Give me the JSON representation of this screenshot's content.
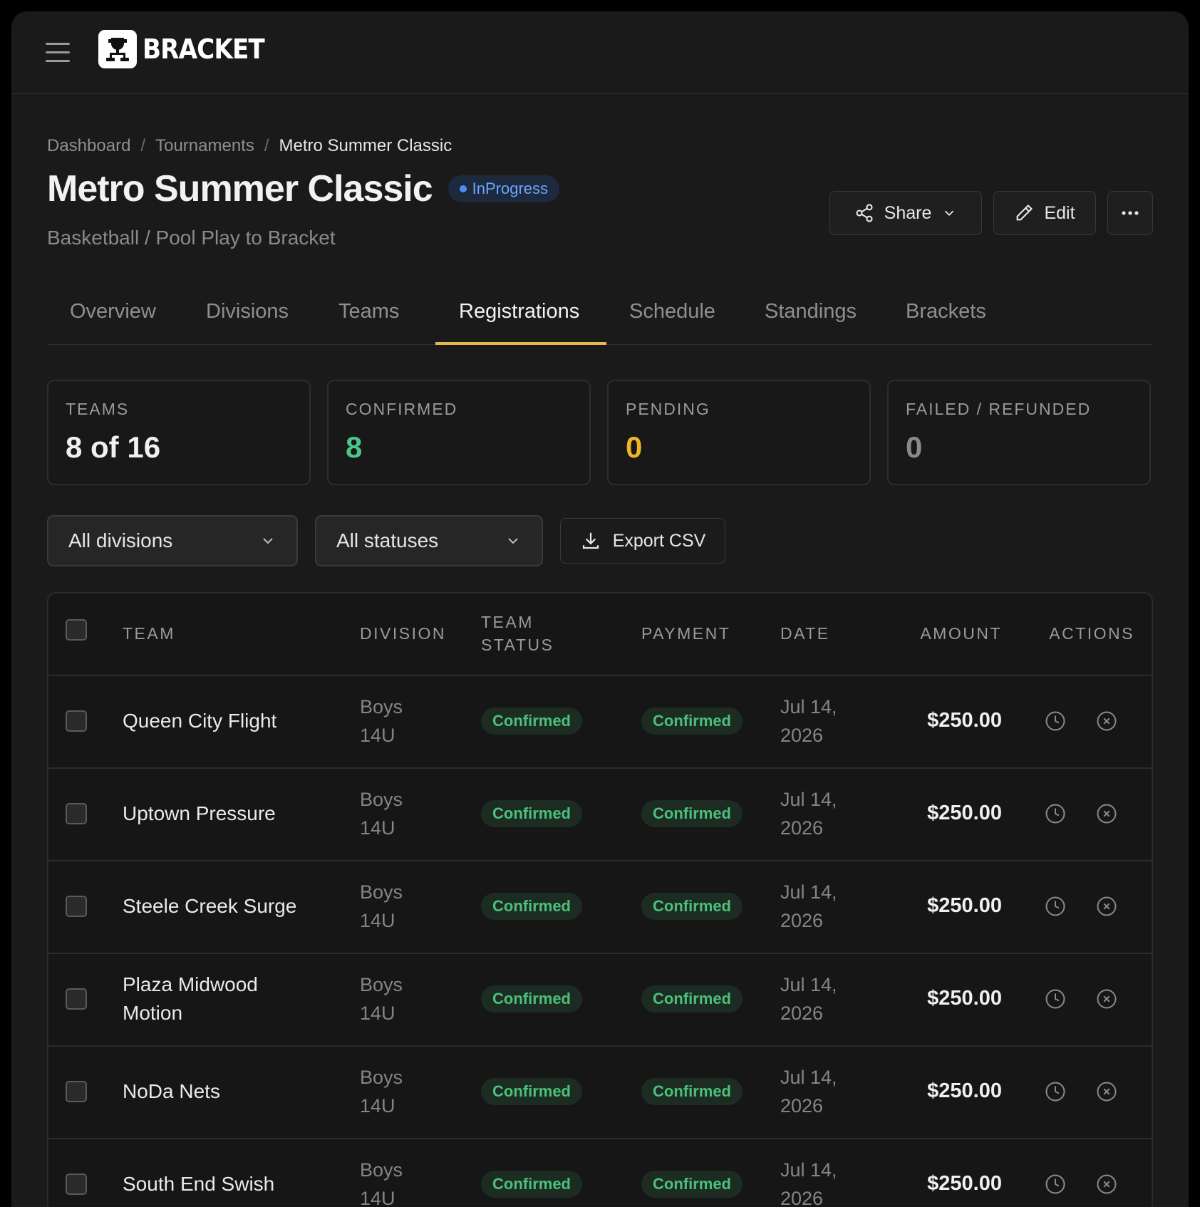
{
  "app": {
    "brand": "BRACKET"
  },
  "breadcrumb": [
    "Dashboard",
    "Tournaments",
    "Metro Summer Classic"
  ],
  "breadcrumb_sep": "/",
  "page": {
    "title": "Metro Summer Classic",
    "status": "InProgress",
    "subtitle": "Basketball / Pool Play to Bracket"
  },
  "actions": {
    "share": "Share",
    "edit": "Edit"
  },
  "tabs": [
    "Overview",
    "Divisions",
    "Teams",
    "Registrations",
    "Schedule",
    "Standings",
    "Brackets"
  ],
  "active_tab": "Registrations",
  "stats": [
    {
      "label": "TEAMS",
      "value": "8 of 16",
      "color": "#f0f0f0"
    },
    {
      "label": "CONFIRMED",
      "value": "8",
      "color": "#4cc48a"
    },
    {
      "label": "PENDING",
      "value": "0",
      "color": "#f0b429"
    },
    {
      "label": "FAILED / REFUNDED",
      "value": "0",
      "color": "#8a8a8a"
    }
  ],
  "filters": {
    "division": "All divisions",
    "status": "All statuses",
    "export": "Export CSV"
  },
  "table": {
    "headers": {
      "team": "TEAM",
      "division": "DIVISION",
      "team_status_1": "TEAM",
      "team_status_2": "STATUS",
      "payment": "PAYMENT",
      "date": "DATE",
      "amount": "AMOUNT",
      "actions": "ACTIONS"
    },
    "rows": [
      {
        "team": [
          "Queen City Flight"
        ],
        "division": [
          "Boys",
          "14U"
        ],
        "team_status": "Confirmed",
        "payment": "Confirmed",
        "date": [
          "Jul 14,",
          "2026"
        ],
        "amount": "$250.00"
      },
      {
        "team": [
          "Uptown Pressure"
        ],
        "division": [
          "Boys",
          "14U"
        ],
        "team_status": "Confirmed",
        "payment": "Confirmed",
        "date": [
          "Jul 14,",
          "2026"
        ],
        "amount": "$250.00"
      },
      {
        "team": [
          "Steele Creek Surge"
        ],
        "division": [
          "Boys",
          "14U"
        ],
        "team_status": "Confirmed",
        "payment": "Confirmed",
        "date": [
          "Jul 14,",
          "2026"
        ],
        "amount": "$250.00"
      },
      {
        "team": [
          "Plaza Midwood",
          "Motion"
        ],
        "division": [
          "Boys",
          "14U"
        ],
        "team_status": "Confirmed",
        "payment": "Confirmed",
        "date": [
          "Jul 14,",
          "2026"
        ],
        "amount": "$250.00"
      },
      {
        "team": [
          "NoDa Nets"
        ],
        "division": [
          "Boys",
          "14U"
        ],
        "team_status": "Confirmed",
        "payment": "Confirmed",
        "date": [
          "Jul 14,",
          "2026"
        ],
        "amount": "$250.00"
      },
      {
        "team": [
          "South End Swish"
        ],
        "division": [
          "Boys",
          "14U"
        ],
        "team_status": "Confirmed",
        "payment": "Confirmed",
        "date": [
          "Jul 14,",
          "2026"
        ],
        "amount": "$250.00"
      }
    ]
  },
  "icons": {
    "menu": "hamburger-icon",
    "logo": "trophy-bracket-icon",
    "share": "share-icon",
    "edit": "pencil-icon",
    "more": "ellipsis-icon",
    "chevron": "chevron-down-icon",
    "export": "download-icon",
    "history": "clock-icon",
    "cancel": "x-circle-icon"
  },
  "colors": {
    "accent_tab": "#e6b84c",
    "status_badge": "#6aa5ff",
    "confirmed": "#4bc07a"
  }
}
